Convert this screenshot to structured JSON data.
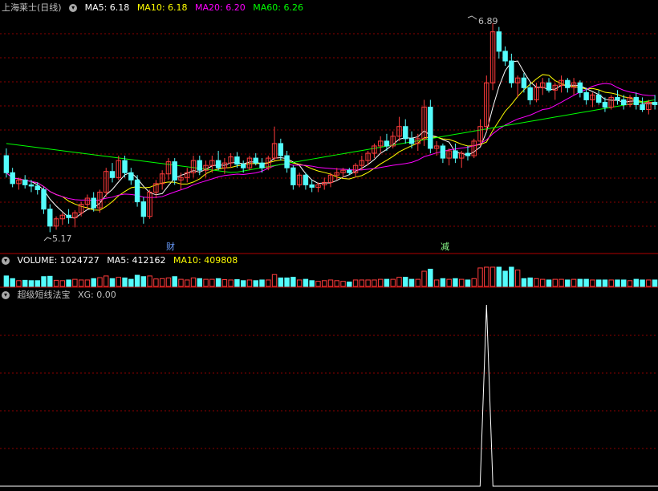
{
  "main_panel": {
    "title": "上海莱士(日线)",
    "ma5_label": "MA5: 6.18",
    "ma10_label": "MA10: 6.18",
    "ma20_label": "MA20: 6.20",
    "ma60_label": "MA60: 6.26",
    "high_marker": "6.89",
    "low_marker": "5.17",
    "event_1": "财",
    "event_2": "减"
  },
  "volume_panel": {
    "label": "VOLUME: 1024727",
    "ma5_label": "MA5: 412162",
    "ma10_label": "MA10: 409808"
  },
  "indicator_panel": {
    "name": "超级短线法宝",
    "xg_label": "XG: 0.00"
  },
  "colors": {
    "background": "#000000",
    "up": "#ff3c3c",
    "down": "#54fcfc",
    "ma5": "#ffffff",
    "ma10": "#ffff00",
    "ma20": "#ff00ff",
    "ma60": "#00ff00",
    "grid": "#8b0000",
    "divider": "#b00000"
  },
  "chart_data": {
    "type": "candlestick",
    "price_range": [
      5.1,
      6.95
    ],
    "ohlc": [
      [
        5.8,
        5.86,
        5.62,
        5.66
      ],
      [
        5.66,
        5.7,
        5.54,
        5.57
      ],
      [
        5.57,
        5.62,
        5.52,
        5.6
      ],
      [
        5.6,
        5.64,
        5.53,
        5.56
      ],
      [
        5.56,
        5.6,
        5.5,
        5.55
      ],
      [
        5.55,
        5.58,
        5.48,
        5.52
      ],
      [
        5.52,
        5.54,
        5.32,
        5.36
      ],
      [
        5.36,
        5.4,
        5.17,
        5.22
      ],
      [
        5.22,
        5.3,
        5.19,
        5.28
      ],
      [
        5.28,
        5.33,
        5.23,
        5.31
      ],
      [
        5.31,
        5.36,
        5.24,
        5.29
      ],
      [
        5.29,
        5.35,
        5.21,
        5.33
      ],
      [
        5.33,
        5.42,
        5.3,
        5.4
      ],
      [
        5.4,
        5.48,
        5.36,
        5.45
      ],
      [
        5.45,
        5.5,
        5.34,
        5.37
      ],
      [
        5.37,
        5.52,
        5.33,
        5.5
      ],
      [
        5.5,
        5.7,
        5.46,
        5.67
      ],
      [
        5.67,
        5.74,
        5.58,
        5.62
      ],
      [
        5.62,
        5.8,
        5.6,
        5.76
      ],
      [
        5.76,
        5.8,
        5.62,
        5.66
      ],
      [
        5.66,
        5.7,
        5.56,
        5.6
      ],
      [
        5.6,
        5.64,
        5.38,
        5.42
      ],
      [
        5.42,
        5.46,
        5.24,
        5.3
      ],
      [
        5.3,
        5.52,
        5.28,
        5.5
      ],
      [
        5.5,
        5.6,
        5.45,
        5.57
      ],
      [
        5.57,
        5.68,
        5.52,
        5.65
      ],
      [
        5.65,
        5.78,
        5.6,
        5.75
      ],
      [
        5.75,
        5.78,
        5.56,
        5.6
      ],
      [
        5.6,
        5.66,
        5.52,
        5.62
      ],
      [
        5.62,
        5.7,
        5.58,
        5.66
      ],
      [
        5.66,
        5.8,
        5.62,
        5.76
      ],
      [
        5.76,
        5.8,
        5.64,
        5.68
      ],
      [
        5.68,
        5.76,
        5.62,
        5.72
      ],
      [
        5.72,
        5.8,
        5.66,
        5.76
      ],
      [
        5.76,
        5.84,
        5.68,
        5.7
      ],
      [
        5.7,
        5.78,
        5.65,
        5.74
      ],
      [
        5.74,
        5.82,
        5.7,
        5.79
      ],
      [
        5.79,
        5.83,
        5.7,
        5.73
      ],
      [
        5.73,
        5.76,
        5.66,
        5.7
      ],
      [
        5.7,
        5.8,
        5.68,
        5.78
      ],
      [
        5.78,
        5.82,
        5.72,
        5.74
      ],
      [
        5.74,
        5.78,
        5.66,
        5.7
      ],
      [
        5.7,
        5.8,
        5.68,
        5.78
      ],
      [
        5.78,
        6.04,
        5.76,
        5.9
      ],
      [
        5.9,
        5.94,
        5.76,
        5.8
      ],
      [
        5.8,
        5.84,
        5.66,
        5.7
      ],
      [
        5.7,
        5.72,
        5.52,
        5.56
      ],
      [
        5.56,
        5.66,
        5.54,
        5.64
      ],
      [
        5.64,
        5.66,
        5.52,
        5.56
      ],
      [
        5.56,
        5.6,
        5.5,
        5.54
      ],
      [
        5.54,
        5.58,
        5.5,
        5.56
      ],
      [
        5.56,
        5.62,
        5.52,
        5.58
      ],
      [
        5.58,
        5.66,
        5.54,
        5.64
      ],
      [
        5.64,
        5.7,
        5.6,
        5.66
      ],
      [
        5.66,
        5.7,
        5.62,
        5.68
      ],
      [
        5.68,
        5.7,
        5.64,
        5.66
      ],
      [
        5.66,
        5.74,
        5.62,
        5.72
      ],
      [
        5.72,
        5.8,
        5.68,
        5.76
      ],
      [
        5.76,
        5.84,
        5.72,
        5.82
      ],
      [
        5.82,
        5.9,
        5.78,
        5.88
      ],
      [
        5.88,
        5.96,
        5.82,
        5.92
      ],
      [
        5.92,
        5.98,
        5.84,
        5.88
      ],
      [
        5.88,
        6.0,
        5.86,
        5.96
      ],
      [
        5.96,
        6.12,
        5.92,
        6.04
      ],
      [
        6.04,
        6.1,
        5.9,
        5.94
      ],
      [
        5.94,
        6.0,
        5.86,
        5.9
      ],
      [
        5.9,
        5.98,
        5.84,
        5.94
      ],
      [
        5.94,
        6.26,
        5.88,
        6.2
      ],
      [
        6.2,
        6.26,
        5.82,
        5.86
      ],
      [
        5.86,
        5.92,
        5.8,
        5.88
      ],
      [
        5.88,
        5.9,
        5.74,
        5.78
      ],
      [
        5.78,
        5.86,
        5.72,
        5.84
      ],
      [
        5.84,
        5.9,
        5.74,
        5.78
      ],
      [
        5.78,
        5.84,
        5.7,
        5.82
      ],
      [
        5.82,
        5.88,
        5.76,
        5.8
      ],
      [
        5.8,
        5.94,
        5.78,
        5.92
      ],
      [
        5.92,
        6.1,
        5.88,
        6.04
      ],
      [
        6.04,
        6.46,
        6.0,
        6.4
      ],
      [
        6.4,
        6.89,
        6.34,
        6.82
      ],
      [
        6.82,
        6.86,
        6.6,
        6.66
      ],
      [
        6.66,
        6.7,
        6.54,
        6.58
      ],
      [
        6.58,
        6.64,
        6.36,
        6.4
      ],
      [
        6.4,
        6.46,
        6.28,
        6.44
      ],
      [
        6.44,
        6.48,
        6.32,
        6.36
      ],
      [
        6.36,
        6.4,
        6.22,
        6.26
      ],
      [
        6.26,
        6.4,
        6.24,
        6.36
      ],
      [
        6.36,
        6.44,
        6.3,
        6.4
      ],
      [
        6.4,
        6.44,
        6.32,
        6.34
      ],
      [
        6.34,
        6.4,
        6.26,
        6.38
      ],
      [
        6.38,
        6.46,
        6.32,
        6.42
      ],
      [
        6.42,
        6.44,
        6.32,
        6.36
      ],
      [
        6.36,
        6.44,
        6.3,
        6.4
      ],
      [
        6.4,
        6.42,
        6.28,
        6.32
      ],
      [
        6.32,
        6.36,
        6.22,
        6.26
      ],
      [
        6.26,
        6.32,
        6.2,
        6.3
      ],
      [
        6.3,
        6.34,
        6.22,
        6.24
      ],
      [
        6.24,
        6.28,
        6.16,
        6.2
      ],
      [
        6.2,
        6.3,
        6.18,
        6.28
      ],
      [
        6.28,
        6.34,
        6.22,
        6.26
      ],
      [
        6.26,
        6.3,
        6.18,
        6.22
      ],
      [
        6.22,
        6.3,
        6.2,
        6.28
      ],
      [
        6.28,
        6.32,
        6.18,
        6.22
      ],
      [
        6.22,
        6.28,
        6.16,
        6.18
      ],
      [
        6.18,
        6.26,
        6.14,
        6.24
      ],
      [
        6.24,
        6.3,
        6.18,
        6.22
      ]
    ],
    "ma60_start": 5.9,
    "ma60_end": 6.26,
    "ma60_low": 5.66,
    "volume_max": 1024727,
    "indicator_peak_index": 77
  }
}
